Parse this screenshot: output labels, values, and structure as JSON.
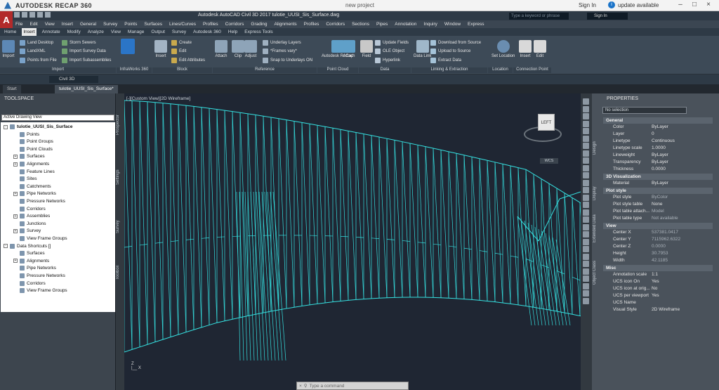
{
  "recap": {
    "title": "AUTODESK  RECAP 360",
    "project": "new project",
    "sign_in": "Sign In",
    "update": "update available"
  },
  "acad": {
    "logo": "A",
    "doc_title": "Autodesk AutoCAD Civil 3D 2017  tulotie_UUSI_Sis_Surface.dwg",
    "search_placeholder": "Type a keyword or phrase",
    "sign_in": "Sign In"
  },
  "menubar": [
    "File",
    "Edit",
    "View",
    "Insert",
    "General",
    "Survey",
    "Points",
    "Surfaces",
    "Lines/Curves",
    "Profiles",
    "Corridors",
    "Grading",
    "Alignments",
    "Profiles",
    "Corridors",
    "Sections",
    "Pipes",
    "Annotation",
    "Inquiry",
    "Window",
    "Express"
  ],
  "ribbon_tabs": [
    "Home",
    "Insert",
    "Annotate",
    "Modify",
    "Analyze",
    "View",
    "Manage",
    "Output",
    "Survey",
    "Autodesk 360",
    "Help",
    "Express Tools"
  ],
  "ribbon": {
    "import": {
      "label": "Import",
      "big": "Import",
      "items": [
        "Land Desktop",
        "LandXML",
        "Points from File",
        "Storm Sewers",
        "Import Survey Data",
        "Import Subassemblies"
      ]
    },
    "infraworks": {
      "label": "InfraWorks 360",
      "big": "Open InfraWorks Model"
    },
    "block": {
      "label": "Block",
      "insert": "Insert",
      "items": [
        "Create",
        "Edit",
        "Edit Attributes"
      ]
    },
    "reference": {
      "label": "Reference",
      "attach": "Attach",
      "clip": "Clip",
      "adjust": "Adjust",
      "items": [
        "Underlay Layers",
        "*Frames vary*",
        "Snap to Underlays ON"
      ]
    },
    "pointcloud": {
      "label": "Point Cloud",
      "b1": "Autodesk ReCap",
      "b2": "Attach"
    },
    "data": {
      "label": "Data",
      "field": "Field",
      "items": [
        "Update Fields",
        "OLE Object",
        "Hyperlink"
      ]
    },
    "linking": {
      "label": "Linking & Extraction",
      "datalink": "Data Link",
      "items": [
        "Download from Source",
        "Upload to Source",
        "Extract Data"
      ]
    },
    "location": {
      "label": "Location",
      "set": "Set Location"
    },
    "connection": {
      "label": "Connection Point",
      "insert": "Insert",
      "edit": "Edit"
    }
  },
  "workspace": "Civil 3D",
  "doc_tabs": [
    "Start",
    "tulotie_UUSI_Sis_Surface*"
  ],
  "toolspace": {
    "title": "TOOLSPACE",
    "view": "Active Drawing View",
    "tree": [
      {
        "label": "tulotie_UUSI_Sis_Surface",
        "level": 0,
        "toggle": "-",
        "bold": true
      },
      {
        "label": "Points",
        "level": 1
      },
      {
        "label": "Point Groups",
        "level": 1
      },
      {
        "label": "Point Clouds",
        "level": 1
      },
      {
        "label": "Surfaces",
        "level": 1,
        "toggle": "+"
      },
      {
        "label": "Alignments",
        "level": 1,
        "toggle": "+"
      },
      {
        "label": "Feature Lines",
        "level": 1
      },
      {
        "label": "Sites",
        "level": 1
      },
      {
        "label": "Catchments",
        "level": 1
      },
      {
        "label": "Pipe Networks",
        "level": 1,
        "toggle": "+"
      },
      {
        "label": "Pressure Networks",
        "level": 1
      },
      {
        "label": "Corridors",
        "level": 1
      },
      {
        "label": "Assemblies",
        "level": 1,
        "toggle": "+"
      },
      {
        "label": "Junctions",
        "level": 1
      },
      {
        "label": "Survey",
        "level": 1,
        "toggle": "+"
      },
      {
        "label": "View Frame Groups",
        "level": 1
      },
      {
        "label": "Data Shortcuts []",
        "level": 0,
        "toggle": "-"
      },
      {
        "label": "Surfaces",
        "level": 1
      },
      {
        "label": "Alignments",
        "level": 1,
        "toggle": "+"
      },
      {
        "label": "Pipe Networks",
        "level": 1
      },
      {
        "label": "Pressure Networks",
        "level": 1
      },
      {
        "label": "Corridors",
        "level": 1
      },
      {
        "label": "View Frame Groups",
        "level": 1
      }
    ],
    "side_tabs": [
      "Prospector",
      "Settings",
      "Survey",
      "Toolbox"
    ]
  },
  "viewport": {
    "label": "[-][Custom View][2D Wireframe]",
    "viewcube_face": "LEFT",
    "wcs": "WCS",
    "mesh_color": "#36e0e0"
  },
  "command": {
    "placeholder": "Type a command"
  },
  "properties": {
    "title": "PROPERTIES",
    "selection": "No selection",
    "side_tabs": [
      "Design",
      "Display",
      "Extended Data",
      "Object Class"
    ],
    "groups": [
      {
        "name": "General",
        "rows": [
          [
            "Color",
            "ByLayer"
          ],
          [
            "Layer",
            "0"
          ],
          [
            "Linetype",
            "Continuous"
          ],
          [
            "Linetype scale",
            "1.0000"
          ],
          [
            "Lineweight",
            "ByLayer"
          ],
          [
            "Transparency",
            "ByLayer"
          ],
          [
            "Thickness",
            "0.0000"
          ]
        ]
      },
      {
        "name": "3D Visualization",
        "rows": [
          [
            "Material",
            "ByLayer"
          ]
        ]
      },
      {
        "name": "Plot style",
        "rows": [
          [
            "Plot style",
            "ByColor"
          ],
          [
            "Plot style table",
            "None"
          ],
          [
            "Plot table attach...",
            "Model"
          ],
          [
            "Plot table type",
            "Not available"
          ]
        ]
      },
      {
        "name": "View",
        "rows": [
          [
            "Center X",
            "537381.0417"
          ],
          [
            "Center Y",
            "7115962.6322"
          ],
          [
            "Center Z",
            "0.0000"
          ],
          [
            "Height",
            "30.7953"
          ],
          [
            "Width",
            "42.1185"
          ]
        ]
      },
      {
        "name": "Misc",
        "rows": [
          [
            "Annotation scale",
            "1:1"
          ],
          [
            "UCS icon On",
            "Yes"
          ],
          [
            "UCS icon at orig...",
            "No"
          ],
          [
            "UCS per viewport",
            "Yes"
          ],
          [
            "UCS Name",
            ""
          ],
          [
            "Visual Style",
            "2D Wireframe"
          ]
        ]
      }
    ]
  }
}
